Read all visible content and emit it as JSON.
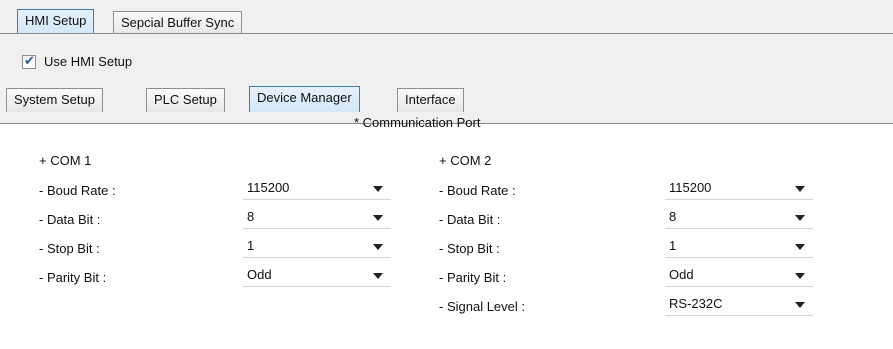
{
  "top_tabs": [
    {
      "label": "HMI Setup"
    },
    {
      "label": "Sepcial Buffer Sync"
    }
  ],
  "use_hmi": {
    "label": "Use HMI Setup",
    "checked": true
  },
  "sub_tabs": [
    {
      "label": "System Setup"
    },
    {
      "label": "PLC Setup"
    },
    {
      "label": "Device Manager"
    },
    {
      "label": "Interface"
    }
  ],
  "section_title": "* Communication Port",
  "com1": {
    "title": "+ COM 1",
    "boud_label": "- Boud Rate :",
    "boud_value": "115200",
    "data_label": "- Data Bit :",
    "data_value": "8",
    "stop_label": "- Stop Bit :",
    "stop_value": "1",
    "parity_label": "- Parity Bit :",
    "parity_value": "Odd"
  },
  "com2": {
    "title": "+ COM 2",
    "boud_label": "- Boud Rate :",
    "boud_value": "115200",
    "data_label": "- Data Bit :",
    "data_value": "8",
    "stop_label": "- Stop Bit :",
    "stop_value": "1",
    "parity_label": "- Parity Bit :",
    "parity_value": "Odd",
    "signal_label": "- Signal Level :",
    "signal_value": "RS-232C"
  },
  "colors": {
    "active_tab": "#d1e8fa",
    "panel_bg": "#f0f0f0",
    "checkmark": "#2a5a9c"
  }
}
